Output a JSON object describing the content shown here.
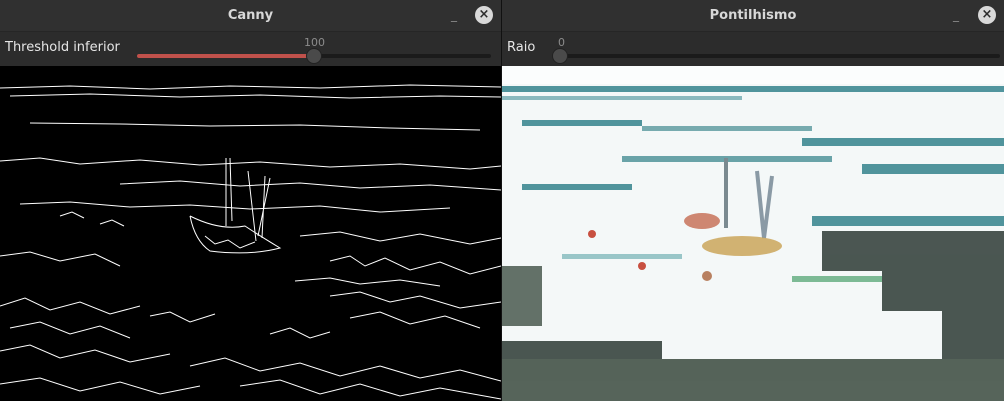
{
  "windows": {
    "canny": {
      "title": "Canny",
      "minimize_glyph": "_",
      "close_glyph": "×",
      "trackbar": {
        "label": "Threshold inferior",
        "value": "100",
        "level_fraction": 0.5
      }
    },
    "pontilhismo": {
      "title": "Pontilhismo",
      "minimize_glyph": "_",
      "close_glyph": "×",
      "trackbar": {
        "label": "Raio",
        "value": "0",
        "level_fraction": 0.0
      }
    }
  },
  "colors": {
    "titlebar": "#303030",
    "trackbar_fill": "#c0514b",
    "canny_background": "#000000",
    "canny_edges": "#ffffff",
    "pontilhismo_background": "#fbfdfd",
    "pontilhismo_water": "#3f8a93",
    "pontilhismo_dark": "#2d3a35"
  },
  "icons": [
    "minimize-icon",
    "close-icon"
  ]
}
